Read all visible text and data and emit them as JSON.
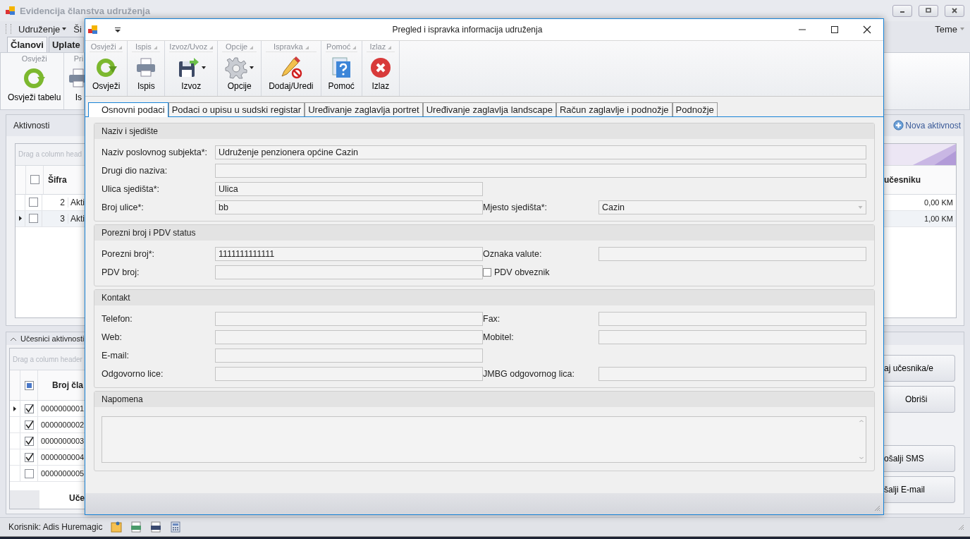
{
  "main_window": {
    "title": "Evidencija članstva udruženja",
    "menu": [
      {
        "label": "Udruženje",
        "dropdown": true
      },
      {
        "label": "Ši",
        "dropdown": false
      }
    ],
    "theme_menu": "Teme",
    "tabs": [
      {
        "label": "Članovi",
        "selected": true
      },
      {
        "label": "Uplate",
        "selected": false
      }
    ],
    "ribbon": [
      {
        "group": "Osvježi",
        "button": "Osvježi tabelu",
        "kind": "refresh"
      },
      {
        "group": "Pri",
        "button": "Is",
        "kind": "print"
      }
    ],
    "activities": {
      "title": "Aktivnosti",
      "select_all_checked": false,
      "add_button": "Nova aktivnost",
      "group_hint": "Drag a column head",
      "columns": [
        "Šifra",
        "učesniku"
      ],
      "rows": [
        {
          "code": "2",
          "name": "Akti",
          "amount": "0,00 KM",
          "current": false,
          "checked": false
        },
        {
          "code": "3",
          "name": "Akti",
          "amount": "1,00 KM",
          "current": true,
          "checked": false
        }
      ]
    },
    "participants": {
      "title": "Učesnici aktivnosti",
      "group_hint": "Drag a column header",
      "column": "Broj čla",
      "select_all_partial": true,
      "rows": [
        {
          "number": "0000000001",
          "checked": true,
          "current": true
        },
        {
          "number": "0000000002",
          "checked": true,
          "current": false
        },
        {
          "number": "0000000003",
          "checked": true,
          "current": false
        },
        {
          "number": "0000000004",
          "checked": true,
          "current": false
        },
        {
          "number": "0000000005",
          "checked": false,
          "current": false
        }
      ],
      "footer": "Uče",
      "buttons": [
        "aj učesnika/e",
        "Obriši",
        "ošalji SMS",
        "šalji E-mail"
      ]
    },
    "status_bar": {
      "user": "Korisnik: Adis Huremagic"
    }
  },
  "dialog": {
    "title": "Pregled i ispravka informacija udruženja",
    "ribbon": [
      {
        "group": "Osvježi",
        "button": "Osvježi",
        "kind": "refresh",
        "dropdown": false
      },
      {
        "group": "Ispis",
        "button": "Ispis",
        "kind": "print",
        "dropdown": false
      },
      {
        "group": "Izvoz/Uvoz",
        "button": "Izvoz",
        "kind": "save",
        "dropdown": true
      },
      {
        "group": "Opcije",
        "button": "Opcije",
        "kind": "gear",
        "dropdown": true
      },
      {
        "group": "Ispravka",
        "button": "Dodaj/Uredi",
        "kind": "edit",
        "dropdown": false
      },
      {
        "group": "Pomoć",
        "button": "Pomoć",
        "kind": "help",
        "dropdown": false
      },
      {
        "group": "Izlaz",
        "button": "Izlaz",
        "kind": "exit",
        "dropdown": false
      }
    ],
    "tabs": [
      {
        "label": "Osnovni podaci",
        "selected": true
      },
      {
        "label": "Podaci o upisu u sudski registar",
        "selected": false
      },
      {
        "label": "Uređivanje zaglavlja portret",
        "selected": false
      },
      {
        "label": "Uređivanje zaglavlja landscape",
        "selected": false
      },
      {
        "label": "Račun zaglavlje i podnožje",
        "selected": false
      },
      {
        "label": "Podnožje",
        "selected": false
      }
    ],
    "sections": [
      {
        "title": "Naziv i sjedište",
        "rows": [
          [
            {
              "label": "Naziv poslovnog subjekta*:",
              "value": "Udruženje penzionera općine Cazin",
              "kind": "text",
              "wide": true
            }
          ],
          [
            {
              "label": "Drugi dio naziva:",
              "kind": "text",
              "wide": true
            }
          ],
          [
            {
              "label": "Ulica sjedišta*:",
              "value": "Ulica",
              "kind": "text",
              "wide": false
            }
          ],
          [
            {
              "label": "Broj ulice*:",
              "value": "bb",
              "kind": "text",
              "wide": false
            },
            {
              "label": "Mjesto sjedišta*:",
              "value": "Cazin",
              "kind": "combo",
              "wide": false
            }
          ]
        ]
      },
      {
        "title": "Porezni broj i PDV status",
        "rows": [
          [
            {
              "label": "Porezni broj*:",
              "value": "1111111111111",
              "kind": "text",
              "wide": false
            },
            {
              "label": "Oznaka valute:",
              "kind": "text",
              "wide": false
            }
          ],
          [
            {
              "label": "PDV broj:",
              "kind": "text",
              "wide": false
            },
            {
              "label": "PDV obveznik",
              "kind": "check",
              "checked": false
            }
          ]
        ]
      },
      {
        "title": "Kontakt",
        "rows": [
          [
            {
              "label": "Telefon:",
              "kind": "text",
              "wide": false
            },
            {
              "label": "Fax:",
              "kind": "text",
              "wide": false
            }
          ],
          [
            {
              "label": "Web:",
              "kind": "text",
              "wide": false
            },
            {
              "label": "Mobitel:",
              "kind": "text",
              "wide": false
            }
          ],
          [
            {
              "label": "E-mail:",
              "kind": "text",
              "wide": false
            }
          ],
          [
            {
              "label": "Odgovorno lice:",
              "kind": "text",
              "wide": false
            },
            {
              "label": "JMBG odgovornog lica:",
              "kind": "text",
              "wide": false
            }
          ]
        ]
      },
      {
        "title": "Napomena",
        "rows": [
          [
            {
              "kind": "memo"
            }
          ]
        ]
      }
    ]
  }
}
